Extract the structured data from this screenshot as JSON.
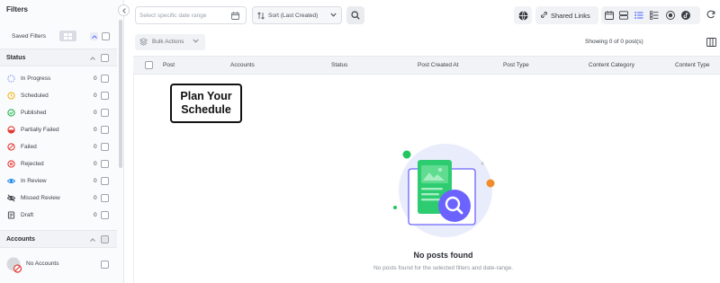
{
  "sidebar": {
    "title": "Filters",
    "saved_filters_label": "Saved Filters",
    "status_section": {
      "title": "Status"
    },
    "statuses": [
      {
        "label": "In Progress",
        "count": "0",
        "icon": "in-progress-icon",
        "color": "#7b8cff"
      },
      {
        "label": "Scheduled",
        "count": "0",
        "icon": "scheduled-icon",
        "color": "#f2b61b"
      },
      {
        "label": "Published",
        "count": "0",
        "icon": "published-icon",
        "color": "#22b24c"
      },
      {
        "label": "Partially Failed",
        "count": "0",
        "icon": "partially-failed-icon",
        "color": "#e53935"
      },
      {
        "label": "Failed",
        "count": "0",
        "icon": "failed-icon",
        "color": "#e53935"
      },
      {
        "label": "Rejected",
        "count": "0",
        "icon": "rejected-icon",
        "color": "#e53935"
      },
      {
        "label": "In Review",
        "count": "0",
        "icon": "in-review-icon",
        "color": "#1e88e5"
      },
      {
        "label": "Missed Review",
        "count": "0",
        "icon": "missed-review-icon",
        "color": "#3a3f47"
      },
      {
        "label": "Draft",
        "count": "0",
        "icon": "draft-icon",
        "color": "#3a3f47"
      }
    ],
    "accounts_section": {
      "title": "Accounts"
    },
    "no_accounts_label": "No Accounts"
  },
  "topbar": {
    "date_placeholder": "Select specific date range",
    "sort_label": "Sort (Last Created)",
    "shared_links_label": "Shared Links"
  },
  "toolbar": {
    "bulk_actions_label": "Bulk Actions",
    "showing_text": "Showing 0 of 0 post(s)"
  },
  "table": {
    "columns": [
      "Post",
      "Accounts",
      "Status",
      "Post Created At",
      "Post Type",
      "Content Category",
      "Content Type"
    ]
  },
  "overlay": {
    "line1": "Plan Your",
    "line2": "Schedule"
  },
  "empty_state": {
    "title": "No posts found",
    "subtitle": "No posts found for the selected filters and date-range."
  },
  "colors": {
    "accent": "#6c63ff",
    "green": "#22c55e",
    "orange": "#f28c28"
  }
}
